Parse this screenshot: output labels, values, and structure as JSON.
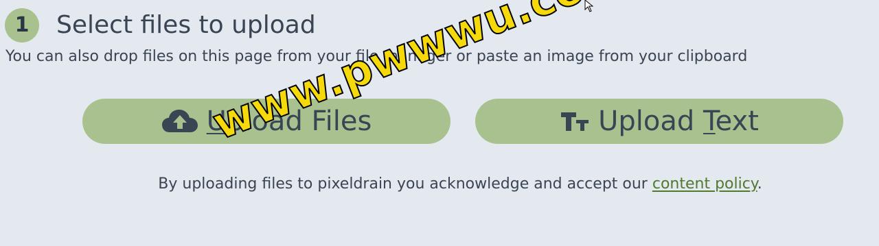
{
  "step": {
    "number": "1",
    "title": "Select files to upload",
    "description": "You can also drop files on this page from your file manager or paste an image from your clipboard"
  },
  "buttons": {
    "upload_files": {
      "icon": "cloud-upload-icon",
      "accesskey": "U",
      "label_rest": "pload Files"
    },
    "upload_text": {
      "icon": "text-size-icon",
      "label_prefix": "Upload ",
      "accesskey": "T",
      "label_rest": "ext"
    }
  },
  "policy": {
    "prefix": "By uploading files to pixeldrain you acknowledge and accept our ",
    "link_text": "content policy",
    "suffix": "."
  },
  "watermark": "www.pwwwu.com",
  "colors": {
    "background": "#e4e8ef",
    "accent": "#a8c18e",
    "text": "#3a4554",
    "link": "#4f7a2e"
  }
}
